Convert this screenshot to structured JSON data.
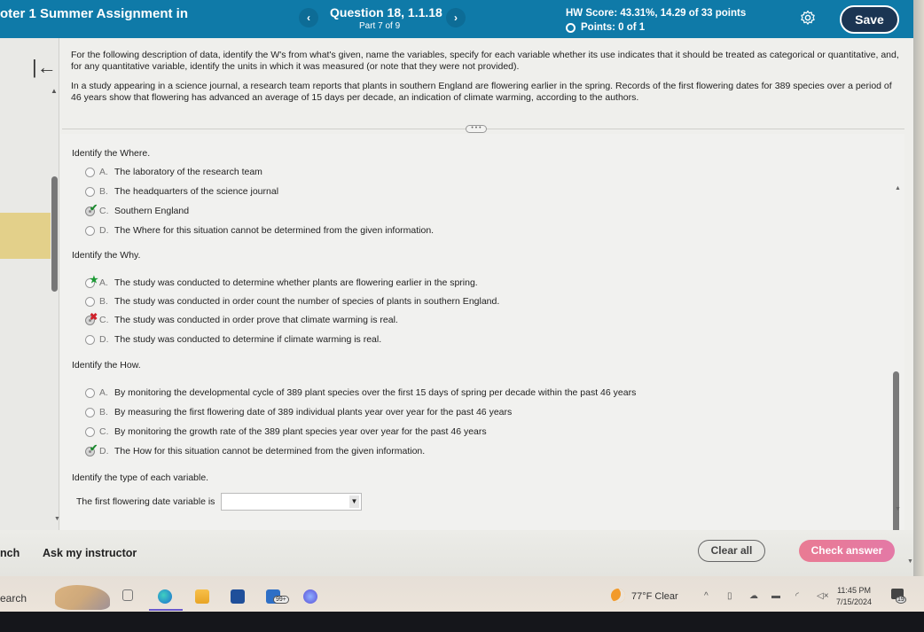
{
  "header": {
    "assignment_title": "oter 1 Summer Assignment in",
    "prev_icon": "‹",
    "next_icon": "›",
    "question_title": "Question 18, 1.1.18",
    "question_part": "Part 7 of 9",
    "hw_score": "HW Score: 43.31%, 14.29 of 33 points",
    "points": "Points: 0 of 1",
    "save_label": "Save"
  },
  "sidebar": {
    "collapse_icon": "|←",
    "up_caret": "▲"
  },
  "intro": {
    "instructions": "For the following description of data, identify the W's from what's given, name the variables, specify for each variable whether its use indicates that it should be treated as categorical or quantitative, and, for any quantitative variable, identify the units in which it was measured (or note that they were not provided).",
    "scenario": "In a study appearing in a science journal, a research team reports that plants in southern England are flowering earlier in the spring. Records of the first flowering dates for 389 species over a period of 46 years show that flowering has advanced an average of 15 days per decade, an indication of climate warming, according to the authors.",
    "more_label": "• • •"
  },
  "questions": [
    {
      "prompt": "Identify the Where.",
      "options": [
        {
          "letter": "A.",
          "text": "The laboratory of the research team",
          "selected": false,
          "mark": ""
        },
        {
          "letter": "B.",
          "text": "The headquarters of the science journal",
          "selected": false,
          "mark": ""
        },
        {
          "letter": "C.",
          "text": "Southern England",
          "selected": true,
          "mark": "✔"
        },
        {
          "letter": "D.",
          "text": "The Where for this situation cannot be determined from the given information.",
          "selected": false,
          "mark": ""
        }
      ]
    },
    {
      "prompt": "Identify the Why.",
      "options": [
        {
          "letter": "A.",
          "text": "The study was conducted to determine whether plants are flowering earlier in the spring.",
          "selected": false,
          "mark": "★"
        },
        {
          "letter": "B.",
          "text": "The study was conducted in order count the number of species of plants in southern England.",
          "selected": false,
          "mark": ""
        },
        {
          "letter": "C.",
          "text": "The study was conducted in order prove that climate warming is real.",
          "selected": true,
          "mark": "✖"
        },
        {
          "letter": "D.",
          "text": "The study was conducted to determine if climate warming is real.",
          "selected": false,
          "mark": ""
        }
      ]
    },
    {
      "prompt": "Identify the How.",
      "options": [
        {
          "letter": "A.",
          "text": "By monitoring the developmental cycle of 389 plant species over the first 15 days of spring per decade within the past 46 years",
          "selected": false,
          "mark": ""
        },
        {
          "letter": "B.",
          "text": "By measuring the first flowering date of 389 individual plants year over year for the past 46 years",
          "selected": false,
          "mark": ""
        },
        {
          "letter": "C.",
          "text": "By monitoring the growth rate of the 389 plant species year over year for the past 46 years",
          "selected": false,
          "mark": ""
        },
        {
          "letter": "D.",
          "text": "The How for this situation cannot be determined from the given information.",
          "selected": true,
          "mark": "✔"
        }
      ]
    },
    {
      "prompt": "Identify the type of each variable.",
      "dropdown_label": "The first flowering date variable is",
      "dropdown_value": "",
      "dropdown_arrow": "▼"
    }
  ],
  "footer": {
    "learn_label": "nch",
    "ask_label": "Ask my instructor",
    "clear_label": "Clear all",
    "check_label": "Check answer"
  },
  "taskbar": {
    "search_label": "earch",
    "mail_badge": "99+",
    "weather": "77°F  Clear",
    "tray_chevron": "^",
    "time": "11:45 PM",
    "date": "7/15/2024",
    "notification_count": "19"
  },
  "colors": {
    "header_bg": "#0f7aa8",
    "save_bg": "#1b3553",
    "check_answer": "#e97b93",
    "correct": "#1c8a2f",
    "incorrect": "#d0202a"
  }
}
